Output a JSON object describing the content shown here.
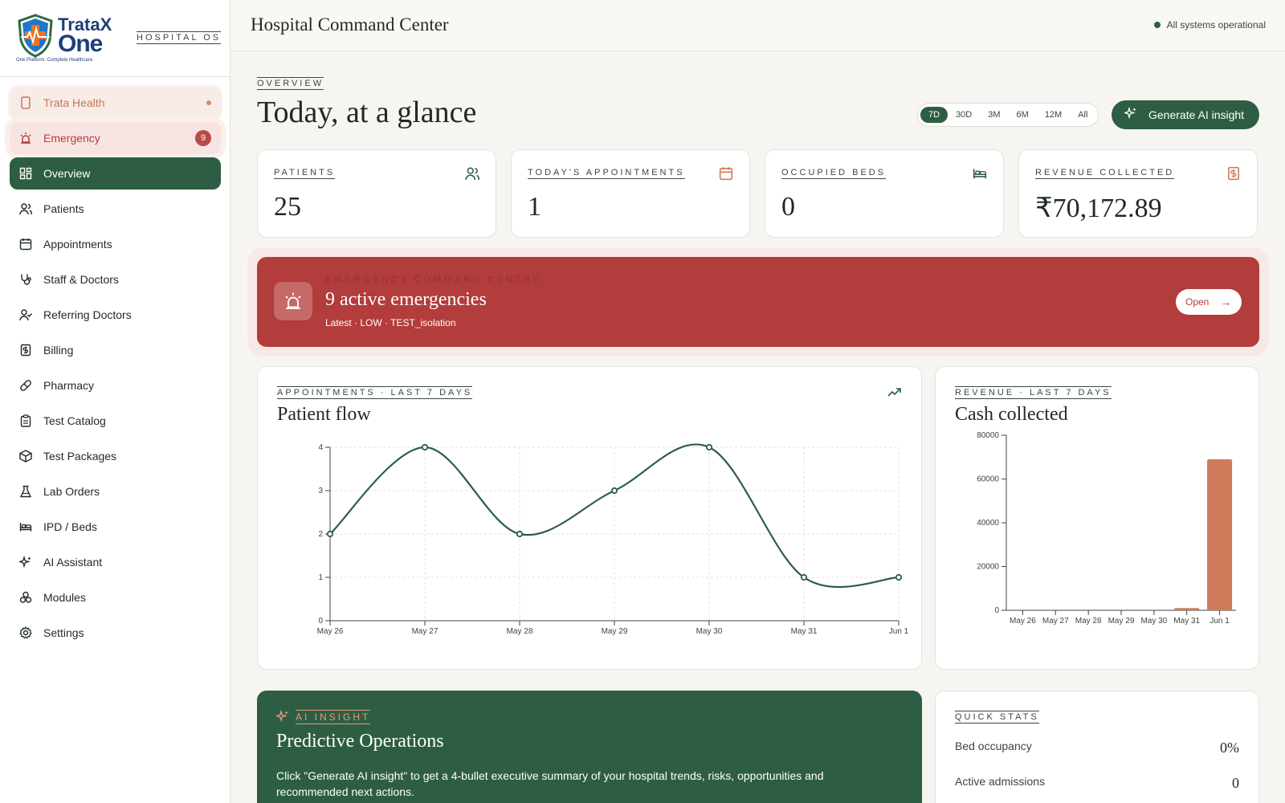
{
  "brand": {
    "logo_line1": "TrataX",
    "logo_line2": "One",
    "logo_tagline": "One Platform. Complete Healthcare.",
    "product_label": "HOSPITAL OS"
  },
  "sidebar": {
    "items": [
      {
        "label": "Trata Health",
        "icon": "device-icon"
      },
      {
        "label": "Emergency",
        "icon": "siren-icon",
        "badge": "9"
      },
      {
        "label": "Overview",
        "icon": "dashboard-icon",
        "active": true
      },
      {
        "label": "Patients",
        "icon": "users-icon"
      },
      {
        "label": "Appointments",
        "icon": "calendar-icon"
      },
      {
        "label": "Staff & Doctors",
        "icon": "stethoscope-icon"
      },
      {
        "label": "Referring Doctors",
        "icon": "user-check-icon"
      },
      {
        "label": "Billing",
        "icon": "receipt-icon"
      },
      {
        "label": "Pharmacy",
        "icon": "pill-icon"
      },
      {
        "label": "Test Catalog",
        "icon": "clipboard-icon"
      },
      {
        "label": "Test Packages",
        "icon": "package-icon"
      },
      {
        "label": "Lab Orders",
        "icon": "flask-icon"
      },
      {
        "label": "IPD / Beds",
        "icon": "bed-icon"
      },
      {
        "label": "AI Assistant",
        "icon": "sparkles-icon"
      },
      {
        "label": "Modules",
        "icon": "modules-icon"
      },
      {
        "label": "Settings",
        "icon": "gear-icon"
      }
    ]
  },
  "header": {
    "title": "Hospital Command Center",
    "status": "All systems operational"
  },
  "overview": {
    "overline": "OVERVIEW",
    "heading": "Today, at a glance",
    "ranges": [
      "7D",
      "30D",
      "3M",
      "6M",
      "12M",
      "All"
    ],
    "selected_range": "7D",
    "generate_label": "Generate AI insight"
  },
  "kpis": [
    {
      "label": "PATIENTS",
      "value": "25",
      "icon": "users-icon"
    },
    {
      "label": "TODAY'S APPOINTMENTS",
      "value": "1",
      "icon": "calendar-icon"
    },
    {
      "label": "OCCUPIED BEDS",
      "value": "0",
      "icon": "bed-icon"
    },
    {
      "label": "REVENUE COLLECTED",
      "value": "₹70,172.89",
      "icon": "receipt-icon"
    }
  ],
  "emergency": {
    "overline": "EMERGENCY COMMAND CENTRE",
    "title": "9 active emergencies",
    "subtitle": "Latest · LOW · TEST_isolation",
    "open_label": "Open"
  },
  "patient_flow": {
    "overline": "APPOINTMENTS · LAST 7 DAYS",
    "title": "Patient flow"
  },
  "cash": {
    "overline": "REVENUE · LAST 7 DAYS",
    "title": "Cash collected"
  },
  "chart_data": [
    {
      "type": "line",
      "x": [
        "May 26",
        "May 27",
        "May 28",
        "May 29",
        "May 30",
        "May 31",
        "Jun 1"
      ],
      "series": [
        {
          "values": [
            2,
            4,
            2,
            3,
            4,
            1,
            1
          ]
        }
      ],
      "ylim": [
        0,
        4
      ],
      "yticks": [
        0,
        1,
        2,
        3,
        4
      ],
      "grid": true,
      "color": "#2d5e43"
    },
    {
      "type": "bar",
      "categories": [
        "May 26",
        "May 27",
        "May 28",
        "May 29",
        "May 30",
        "May 31",
        "Jun 1"
      ],
      "values": [
        0,
        0,
        0,
        0,
        0,
        1000,
        69000
      ],
      "ylim": [
        0,
        80000
      ],
      "yticks": [
        0,
        20000,
        40000,
        60000,
        80000
      ],
      "grid": false,
      "color": "#cf7a5b"
    }
  ],
  "ai_insight": {
    "overline": "AI INSIGHT",
    "title": "Predictive Operations",
    "body": "Click \"Generate AI insight\" to get a 4-bullet executive summary of your hospital trends, risks, opportunities and recommended next actions."
  },
  "quick_stats": {
    "overline": "QUICK STATS",
    "rows": [
      {
        "label": "Bed occupancy",
        "value": "0%"
      },
      {
        "label": "Active admissions",
        "value": "0"
      }
    ]
  },
  "colors": {
    "primary": "#2d5e43",
    "emergency": "#b33c3c",
    "accent": "#cf7a5b"
  }
}
